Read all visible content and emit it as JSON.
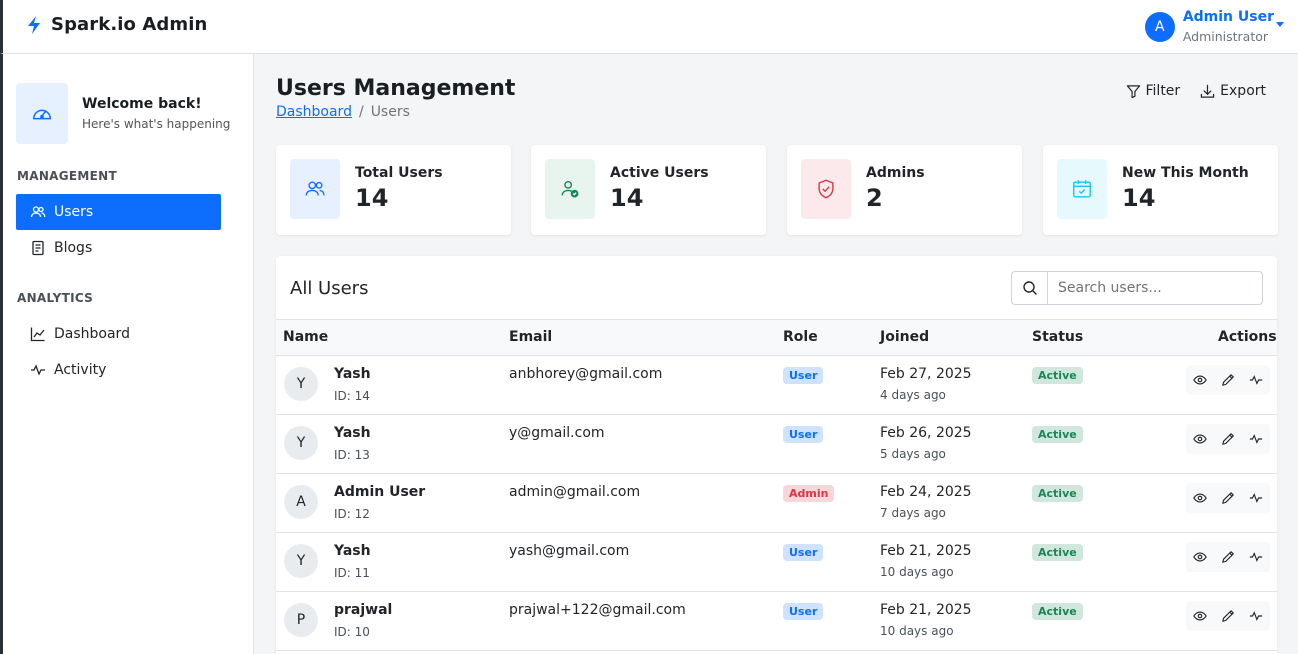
{
  "app": {
    "brand": "Spark.io Admin"
  },
  "user_menu": {
    "initial": "A",
    "name": "Admin User",
    "role": "Administrator"
  },
  "sidebar": {
    "welcome_title": "Welcome back!",
    "welcome_sub": "Here's what's happening",
    "sections": [
      {
        "label": "MANAGEMENT",
        "items": [
          {
            "label": "Users",
            "icon": "users-icon",
            "active": true
          },
          {
            "label": "Blogs",
            "icon": "document-icon"
          }
        ]
      },
      {
        "label": "ANALYTICS",
        "items": [
          {
            "label": "Dashboard",
            "icon": "line-chart-icon"
          },
          {
            "label": "Activity",
            "icon": "activity-icon"
          }
        ]
      }
    ]
  },
  "page": {
    "title": "Users Management",
    "breadcrumb": {
      "link": "Dashboard",
      "separator": "/",
      "current": "Users"
    },
    "filter_label": "Filter",
    "export_label": "Export"
  },
  "stats": [
    {
      "label": "Total Users",
      "value": "14",
      "icon": "users-icon",
      "color": "#0d6efd",
      "bg": "#e7f0ff"
    },
    {
      "label": "Active Users",
      "value": "14",
      "icon": "user-check-icon",
      "color": "#198754",
      "bg": "#e8f5ee"
    },
    {
      "label": "Admins",
      "value": "2",
      "icon": "shield-icon",
      "color": "#dc3545",
      "bg": "#fbe9eb"
    },
    {
      "label": "New This Month",
      "value": "14",
      "icon": "calendar-icon",
      "color": "#0dcaf0",
      "bg": "#e6fafd"
    }
  ],
  "users_table": {
    "title": "All Users",
    "search_placeholder": "Search users...",
    "columns": [
      "Name",
      "Email",
      "Role",
      "Joined",
      "Status",
      "Actions"
    ],
    "rows": [
      {
        "initial": "Y",
        "name": "Yash",
        "id": "ID: 14",
        "email": "anbhorey@gmail.com",
        "role": "User",
        "joined": "Feb 27, 2025",
        "ago": "4 days ago",
        "status": "Active"
      },
      {
        "initial": "Y",
        "name": "Yash",
        "id": "ID: 13",
        "email": "y@gmail.com",
        "role": "User",
        "joined": "Feb 26, 2025",
        "ago": "5 days ago",
        "status": "Active"
      },
      {
        "initial": "A",
        "name": "Admin User",
        "id": "ID: 12",
        "email": "admin@gmail.com",
        "role": "Admin",
        "joined": "Feb 24, 2025",
        "ago": "7 days ago",
        "status": "Active"
      },
      {
        "initial": "Y",
        "name": "Yash",
        "id": "ID: 11",
        "email": "yash@gmail.com",
        "role": "User",
        "joined": "Feb 21, 2025",
        "ago": "10 days ago",
        "status": "Active"
      },
      {
        "initial": "P",
        "name": "prajwal",
        "id": "ID: 10",
        "email": "prajwal+122@gmail.com",
        "role": "User",
        "joined": "Feb 21, 2025",
        "ago": "10 days ago",
        "status": "Active"
      }
    ]
  }
}
